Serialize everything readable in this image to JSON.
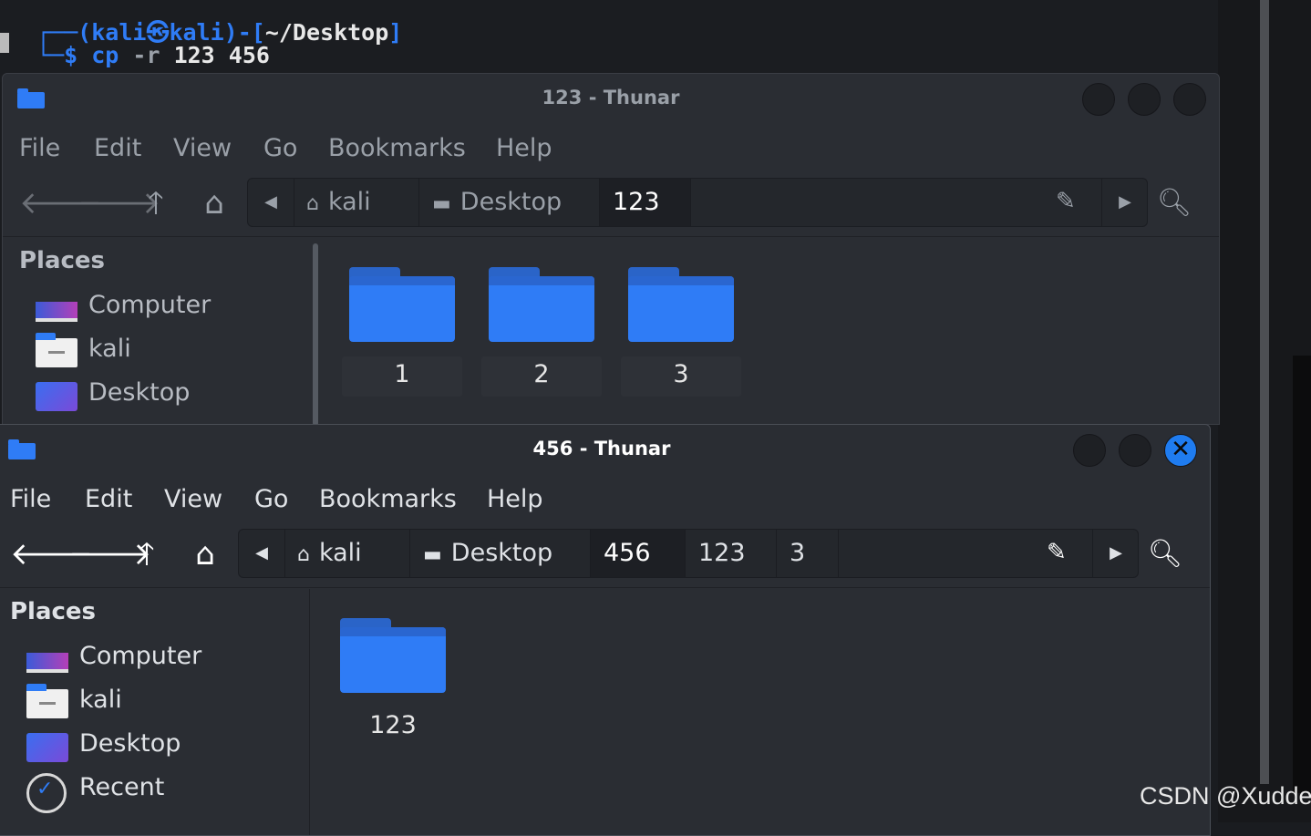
{
  "terminal": {
    "prompt_open": "┌──(",
    "user": "kali",
    "at": "㉿",
    "host": "kali",
    "path_sep": ")-[",
    "path": "~/Desktop",
    "path_close": "]",
    "prompt_line2": "└─",
    "dollar": "$",
    "cmd": "cp",
    "flag": "-r",
    "args": "123 456"
  },
  "windows": {
    "back": {
      "title": "123 - Thunar",
      "menu": [
        "File",
        "Edit",
        "View",
        "Go",
        "Bookmarks",
        "Help"
      ],
      "breadcrumbs": [
        "kali",
        "Desktop",
        "123"
      ],
      "places_title": "Places",
      "places": [
        "Computer",
        "kali",
        "Desktop"
      ],
      "items": [
        "1",
        "2",
        "3"
      ]
    },
    "front": {
      "title": "456 - Thunar",
      "close_glyph": "✕",
      "menu": [
        "File",
        "Edit",
        "View",
        "Go",
        "Bookmarks",
        "Help"
      ],
      "breadcrumbs": [
        "kali",
        "Desktop",
        "456",
        "123",
        "3"
      ],
      "places_title": "Places",
      "places": [
        "Computer",
        "kali",
        "Desktop",
        "Recent"
      ],
      "items": [
        "123"
      ]
    }
  },
  "watermark": "CSDN @Xudde.",
  "colors": {
    "accent": "#2f7cf6",
    "bg": "#2a2d33",
    "terminal_bg": "#1b1d21"
  },
  "icons": {
    "back": "arrow-left-icon",
    "forward": "arrow-right-icon",
    "up": "arrow-up-icon",
    "home": "home-icon",
    "edit_path": "pencil-icon",
    "search": "search-icon",
    "folder": "folder-icon"
  }
}
